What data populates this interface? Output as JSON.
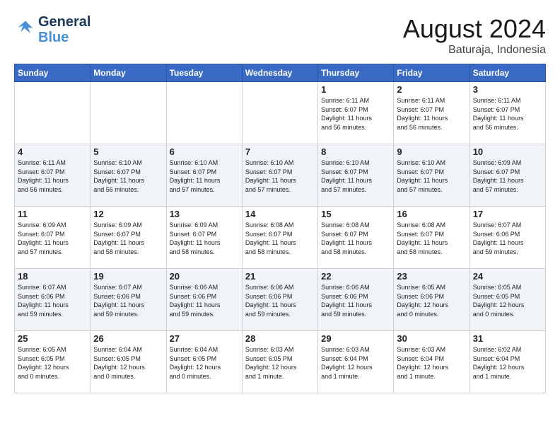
{
  "header": {
    "logo_line1": "General",
    "logo_line2": "Blue",
    "main_title": "August 2024",
    "sub_title": "Baturaja, Indonesia"
  },
  "weekdays": [
    "Sunday",
    "Monday",
    "Tuesday",
    "Wednesday",
    "Thursday",
    "Friday",
    "Saturday"
  ],
  "weeks": [
    [
      {
        "day": "",
        "info": ""
      },
      {
        "day": "",
        "info": ""
      },
      {
        "day": "",
        "info": ""
      },
      {
        "day": "",
        "info": ""
      },
      {
        "day": "1",
        "info": "Sunrise: 6:11 AM\nSunset: 6:07 PM\nDaylight: 11 hours\nand 56 minutes."
      },
      {
        "day": "2",
        "info": "Sunrise: 6:11 AM\nSunset: 6:07 PM\nDaylight: 11 hours\nand 56 minutes."
      },
      {
        "day": "3",
        "info": "Sunrise: 6:11 AM\nSunset: 6:07 PM\nDaylight: 11 hours\nand 56 minutes."
      }
    ],
    [
      {
        "day": "4",
        "info": "Sunrise: 6:11 AM\nSunset: 6:07 PM\nDaylight: 11 hours\nand 56 minutes."
      },
      {
        "day": "5",
        "info": "Sunrise: 6:10 AM\nSunset: 6:07 PM\nDaylight: 11 hours\nand 56 minutes."
      },
      {
        "day": "6",
        "info": "Sunrise: 6:10 AM\nSunset: 6:07 PM\nDaylight: 11 hours\nand 57 minutes."
      },
      {
        "day": "7",
        "info": "Sunrise: 6:10 AM\nSunset: 6:07 PM\nDaylight: 11 hours\nand 57 minutes."
      },
      {
        "day": "8",
        "info": "Sunrise: 6:10 AM\nSunset: 6:07 PM\nDaylight: 11 hours\nand 57 minutes."
      },
      {
        "day": "9",
        "info": "Sunrise: 6:10 AM\nSunset: 6:07 PM\nDaylight: 11 hours\nand 57 minutes."
      },
      {
        "day": "10",
        "info": "Sunrise: 6:09 AM\nSunset: 6:07 PM\nDaylight: 11 hours\nand 57 minutes."
      }
    ],
    [
      {
        "day": "11",
        "info": "Sunrise: 6:09 AM\nSunset: 6:07 PM\nDaylight: 11 hours\nand 57 minutes."
      },
      {
        "day": "12",
        "info": "Sunrise: 6:09 AM\nSunset: 6:07 PM\nDaylight: 11 hours\nand 58 minutes."
      },
      {
        "day": "13",
        "info": "Sunrise: 6:09 AM\nSunset: 6:07 PM\nDaylight: 11 hours\nand 58 minutes."
      },
      {
        "day": "14",
        "info": "Sunrise: 6:08 AM\nSunset: 6:07 PM\nDaylight: 11 hours\nand 58 minutes."
      },
      {
        "day": "15",
        "info": "Sunrise: 6:08 AM\nSunset: 6:07 PM\nDaylight: 11 hours\nand 58 minutes."
      },
      {
        "day": "16",
        "info": "Sunrise: 6:08 AM\nSunset: 6:07 PM\nDaylight: 11 hours\nand 58 minutes."
      },
      {
        "day": "17",
        "info": "Sunrise: 6:07 AM\nSunset: 6:06 PM\nDaylight: 11 hours\nand 59 minutes."
      }
    ],
    [
      {
        "day": "18",
        "info": "Sunrise: 6:07 AM\nSunset: 6:06 PM\nDaylight: 11 hours\nand 59 minutes."
      },
      {
        "day": "19",
        "info": "Sunrise: 6:07 AM\nSunset: 6:06 PM\nDaylight: 11 hours\nand 59 minutes."
      },
      {
        "day": "20",
        "info": "Sunrise: 6:06 AM\nSunset: 6:06 PM\nDaylight: 11 hours\nand 59 minutes."
      },
      {
        "day": "21",
        "info": "Sunrise: 6:06 AM\nSunset: 6:06 PM\nDaylight: 11 hours\nand 59 minutes."
      },
      {
        "day": "22",
        "info": "Sunrise: 6:06 AM\nSunset: 6:06 PM\nDaylight: 11 hours\nand 59 minutes."
      },
      {
        "day": "23",
        "info": "Sunrise: 6:05 AM\nSunset: 6:06 PM\nDaylight: 12 hours\nand 0 minutes."
      },
      {
        "day": "24",
        "info": "Sunrise: 6:05 AM\nSunset: 6:05 PM\nDaylight: 12 hours\nand 0 minutes."
      }
    ],
    [
      {
        "day": "25",
        "info": "Sunrise: 6:05 AM\nSunset: 6:05 PM\nDaylight: 12 hours\nand 0 minutes."
      },
      {
        "day": "26",
        "info": "Sunrise: 6:04 AM\nSunset: 6:05 PM\nDaylight: 12 hours\nand 0 minutes."
      },
      {
        "day": "27",
        "info": "Sunrise: 6:04 AM\nSunset: 6:05 PM\nDaylight: 12 hours\nand 0 minutes."
      },
      {
        "day": "28",
        "info": "Sunrise: 6:03 AM\nSunset: 6:05 PM\nDaylight: 12 hours\nand 1 minute."
      },
      {
        "day": "29",
        "info": "Sunrise: 6:03 AM\nSunset: 6:04 PM\nDaylight: 12 hours\nand 1 minute."
      },
      {
        "day": "30",
        "info": "Sunrise: 6:03 AM\nSunset: 6:04 PM\nDaylight: 12 hours\nand 1 minute."
      },
      {
        "day": "31",
        "info": "Sunrise: 6:02 AM\nSunset: 6:04 PM\nDaylight: 12 hours\nand 1 minute."
      }
    ]
  ]
}
